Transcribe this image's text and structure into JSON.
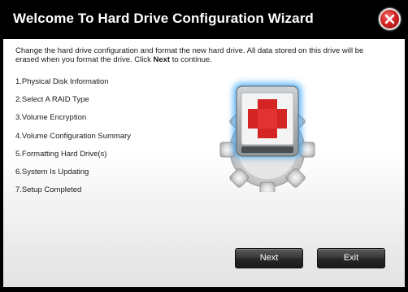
{
  "window": {
    "title": "Welcome To Hard Drive Configuration Wizard",
    "close_icon": "close-icon"
  },
  "intro": {
    "text_before": "Change the hard drive configuration and format the new hard drive. All data stored on this drive will be erased when you format the drive. Click ",
    "emphasis": "Next",
    "text_after": " to continue."
  },
  "steps": [
    "1.Physical Disk Information",
    "2.Select A RAID Type",
    "3.Volume Encryption",
    "4.Volume Configuration Summary",
    "5.Formatting Hard Drive(s)",
    "6.System Is Updating",
    "7.Setup Completed"
  ],
  "illustration": {
    "icon": "hard-drive-gear-icon",
    "accent_color": "#d42424",
    "glow_color": "#3fa9f5"
  },
  "buttons": {
    "next_label": "Next",
    "exit_label": "Exit"
  }
}
